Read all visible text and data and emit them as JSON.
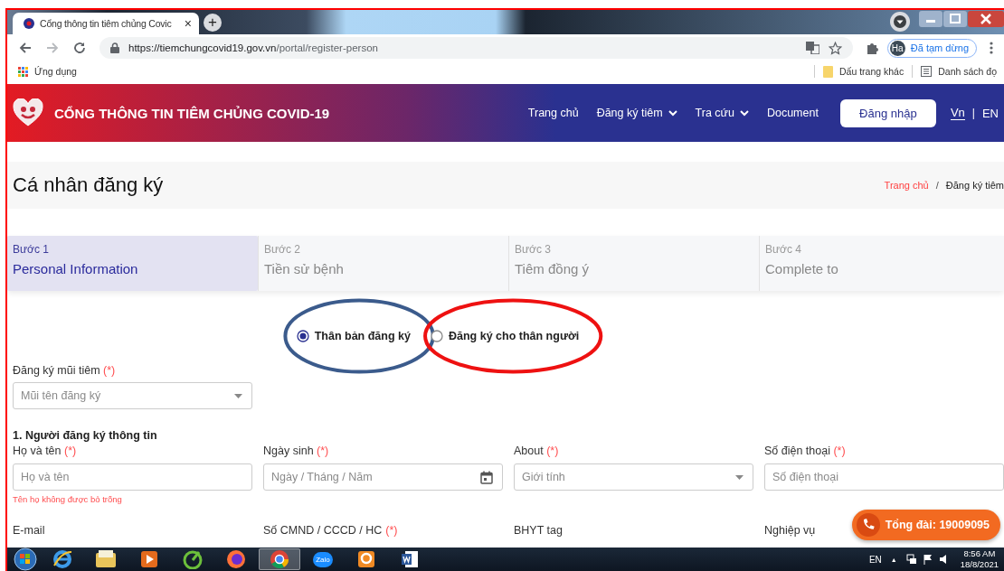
{
  "browser": {
    "tab_title": "Cổng thông tin tiêm chủng Covic",
    "tab_close": "×",
    "new_tab": "+",
    "url_host": "https://tiemchungcovid19.gov.vn",
    "url_path": "/portal/register-person",
    "forward_disabled": true,
    "profile_initials": "Ha",
    "profile_status": "Đã tạm dừng"
  },
  "bookmarks": {
    "apps": "Ứng dụng",
    "other": "Dấu trang khác",
    "reading_list": "Danh sách đọ"
  },
  "header": {
    "title": "CỔNG THÔNG TIN TIÊM CHỦNG COVID-19",
    "nav": [
      {
        "label": "Trang chủ",
        "dropdown": false
      },
      {
        "label": "Đăng ký tiêm",
        "dropdown": true
      },
      {
        "label": "Tra cứu",
        "dropdown": true
      },
      {
        "label": "Document",
        "dropdown": false
      }
    ],
    "login": "Đăng nhập",
    "languages": [
      {
        "label": "Vn",
        "selected": true
      },
      {
        "label": "EN",
        "selected": false
      }
    ],
    "lang_separator": "|"
  },
  "page": {
    "title": "Cá nhân đăng ký",
    "breadcrumb": [
      {
        "label": "Trang chủ",
        "link": true
      },
      {
        "label": "Đăng ký tiêm",
        "link": false
      }
    ],
    "breadcrumb_separator": "/"
  },
  "steps": [
    {
      "step": "Bước 1",
      "title": "Personal Information",
      "selected": true
    },
    {
      "step": "Bước 2",
      "title": "Tiền sử bệnh",
      "selected": false
    },
    {
      "step": "Bước 3",
      "title": "Tiêm đồng ý",
      "selected": false
    },
    {
      "step": "Bước 4",
      "title": "Complete to",
      "selected": false
    }
  ],
  "registrant_type": [
    {
      "label": "Thân bản đăng ký",
      "selected": true,
      "color": "#3b5b8c"
    },
    {
      "label": "Đăng ký cho thân người",
      "selected": false,
      "color": "#ee1111"
    }
  ],
  "dose": {
    "label": "Đăng ký mũi tiêm",
    "required": "(*)",
    "kind": "select",
    "placeholder": "Mũi tên đăng ký"
  },
  "section_title": "1. Người đăng ký thông tin",
  "fields": [
    {
      "label": "Họ và tên",
      "required": "(*)",
      "kind": "text",
      "placeholder": "Họ và tên",
      "error": "Tên họ không được bỏ trống"
    },
    {
      "label": "Ngày sinh",
      "required": "(*)",
      "kind": "date",
      "placeholder": "Ngày / Tháng / Năm"
    },
    {
      "label": "About",
      "required": "(*)",
      "kind": "select",
      "placeholder": "Giới tính"
    },
    {
      "label": "Số điện thoại",
      "required": "(*)",
      "kind": "text",
      "placeholder": "Số điện thoại"
    }
  ],
  "next_labels": [
    {
      "label": "E-mail"
    },
    {
      "label": "Số CMND / CCCD / HC",
      "required": "(*)"
    },
    {
      "label": "BHYT tag"
    },
    {
      "label": "Nghiệp vụ"
    }
  ],
  "hotline": "Tổng đài: 19009095",
  "taskbar": {
    "apps": [
      {
        "kind": "ie",
        "selected": false
      },
      {
        "kind": "explorer",
        "selected": false
      },
      {
        "kind": "media",
        "selected": false
      },
      {
        "kind": "green",
        "selected": false
      },
      {
        "kind": "firefox",
        "selected": false
      },
      {
        "kind": "chrome",
        "selected": true
      },
      {
        "kind": "zalo",
        "label": "Zalo",
        "selected": false
      },
      {
        "kind": "orange",
        "selected": false
      },
      {
        "kind": "word",
        "selected": false
      }
    ],
    "language": "EN",
    "tray_arrow": "▲",
    "time": "8:56 AM",
    "date": "18/8/2021"
  }
}
